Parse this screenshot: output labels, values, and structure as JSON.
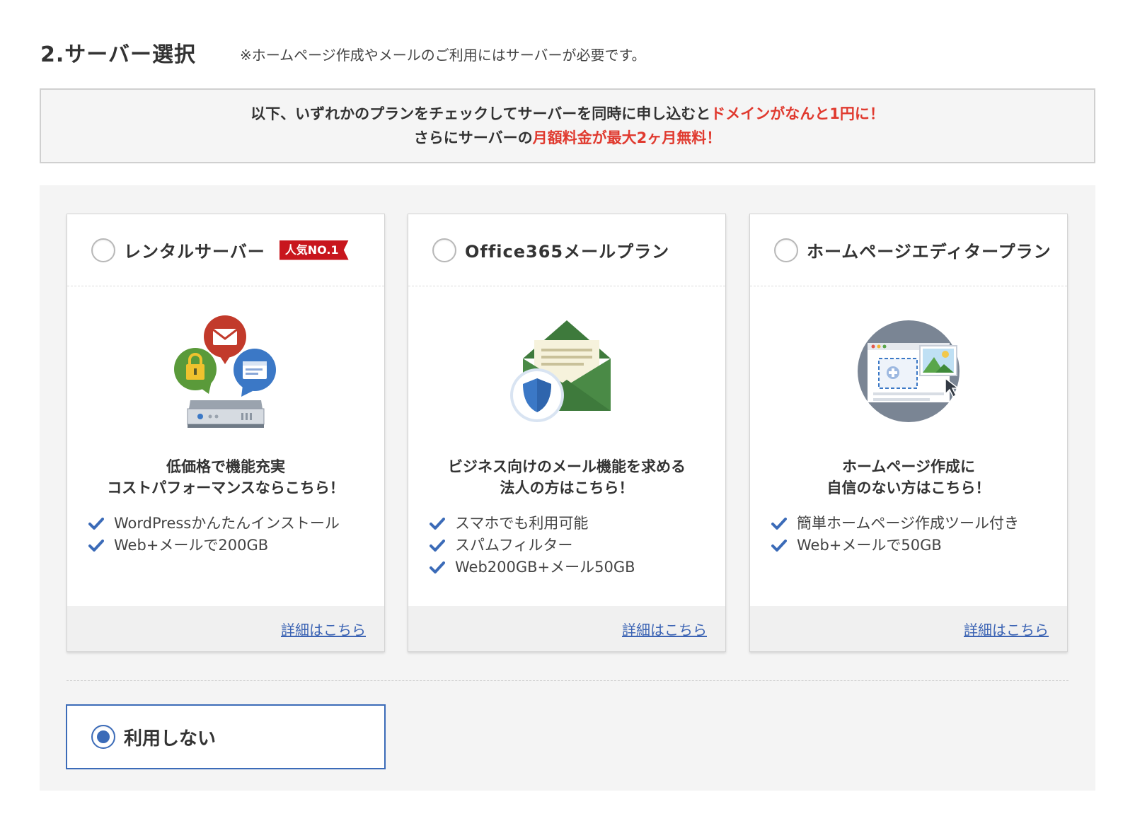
{
  "section": {
    "title": "2.サーバー選択",
    "note": "※ホームページ作成やメールのご利用にはサーバーが必要です。"
  },
  "campaign": {
    "line1_text": "以下、いずれかのプランをチェックしてサーバーを同時に申し込むと",
    "line1_highlight": "ドメインがなんと1円に！",
    "line2_text": "さらにサーバーの",
    "line2_highlight": "月額料金が最大2ヶ月無料！",
    "highlight_color": "#e03a2f"
  },
  "plans": [
    {
      "name": "レンタルサーバー",
      "badge": "人気NO.1",
      "selected": false,
      "icon": "server-network-icon",
      "desc_line1": "低価格で機能充実",
      "desc_line2": "コストパフォーマンスならこちら！",
      "features": [
        "WordPressかんたんインストール",
        "Web+メールで200GB"
      ],
      "detail_link": "詳細はこちら"
    },
    {
      "name": "Office365メールプラン",
      "selected": false,
      "icon": "secure-mail-icon",
      "desc_line1": "ビジネス向けのメール機能を求める",
      "desc_line2": "法人の方はこちら！",
      "features": [
        "スマホでも利用可能",
        "スパムフィルター",
        "Web200GB+メール50GB"
      ],
      "detail_link": "詳細はこちら"
    },
    {
      "name": "ホームページエディタープラン",
      "selected": false,
      "icon": "homepage-editor-icon",
      "desc_line1": "ホームページ作成に",
      "desc_line2": "自信のない方はこちら！",
      "features": [
        "簡単ホームページ作成ツール付き",
        "Web+メールで50GB"
      ],
      "detail_link": "詳細はこちら"
    }
  ],
  "no_use": {
    "label": "利用しない",
    "selected": true
  },
  "colors": {
    "accent": "#3b6bb8",
    "badge_red": "#c8161d",
    "link": "#3c64b4"
  }
}
